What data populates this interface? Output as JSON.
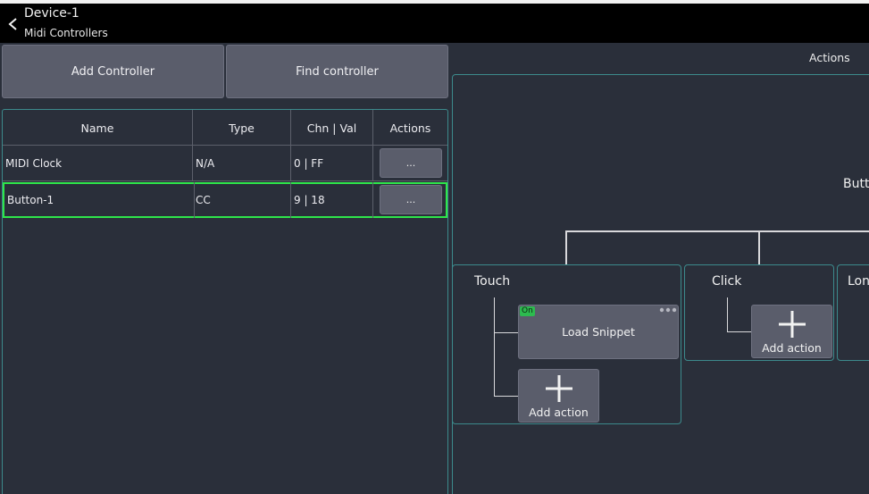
{
  "header": {
    "title": "Device-1",
    "subtitle": "Midi Controllers"
  },
  "toolbar": {
    "add_controller": "Add Controller",
    "find_controller": "Find controller"
  },
  "table": {
    "columns": [
      "Name",
      "Type",
      "Chn | Val",
      "Actions"
    ],
    "rows": [
      {
        "name": "MIDI Clock",
        "type": "N/A",
        "chn_val": "0 | FF",
        "action": "..."
      },
      {
        "name": "Button-1",
        "type": "CC",
        "chn_val": "9 | 18",
        "action": "..."
      }
    ],
    "selected_row": "Button-1"
  },
  "actions": {
    "label": "Actions",
    "root": "Butt",
    "events": [
      {
        "title": "Touch",
        "cards": [
          {
            "label": "Load Snippet",
            "badge": "On"
          },
          {
            "label": "Add action"
          }
        ]
      },
      {
        "title": "Click",
        "cards": [
          {
            "label": "Add action"
          }
        ]
      },
      {
        "title": "Lon",
        "cards": []
      }
    ]
  },
  "colors": {
    "background": "#2a2f3a",
    "header": "#000000",
    "button": "#5a5d6b",
    "panel_border": "#3c8a8c",
    "selected_border": "#2ee64a",
    "on_badge": "#2dbb4f"
  }
}
